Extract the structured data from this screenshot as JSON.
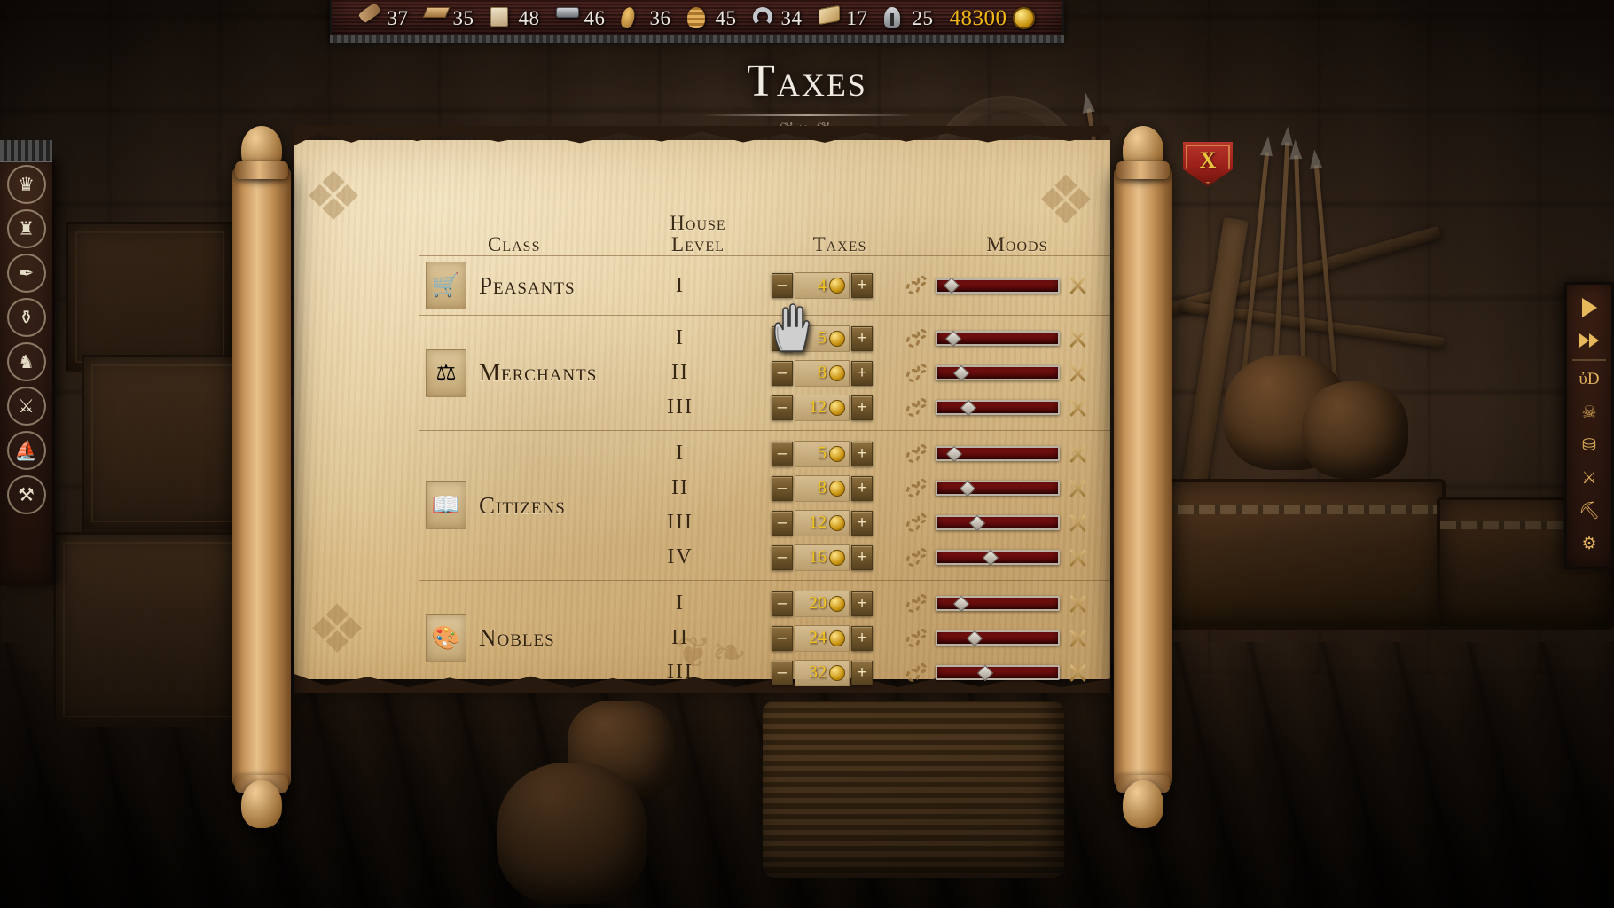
{
  "window": {
    "title": "Taxes"
  },
  "resources": [
    {
      "icon": "log-icon",
      "name": "wood",
      "value": "37"
    },
    {
      "icon": "plank-icon",
      "name": "planks",
      "value": "35"
    },
    {
      "icon": "stone-icon",
      "name": "stone",
      "value": "48"
    },
    {
      "icon": "iron-icon",
      "name": "iron",
      "value": "46"
    },
    {
      "icon": "wheat-icon",
      "name": "grain",
      "value": "36"
    },
    {
      "icon": "hive-icon",
      "name": "beehive",
      "value": "45"
    },
    {
      "icon": "horseshoe-icon",
      "name": "horseshoe",
      "value": "34"
    },
    {
      "icon": "scroll-icon",
      "name": "parchment",
      "value": "17"
    },
    {
      "icon": "helmet-icon",
      "name": "armor",
      "value": "25"
    },
    {
      "icon": "coin-icon",
      "name": "gold",
      "value": "48300"
    }
  ],
  "close_button": {
    "label": "X"
  },
  "table": {
    "headers": {
      "class": "Class",
      "house_level_line1": "House",
      "house_level_line2": "Level",
      "taxes": "Taxes",
      "moods": "Moods"
    },
    "groups": [
      {
        "name": "Peasants",
        "icon": "cart-icon",
        "rows": [
          {
            "level": "I",
            "tax": "4",
            "mood_pct": 12
          }
        ]
      },
      {
        "name": "Merchants",
        "icon": "scales-icon",
        "rows": [
          {
            "level": "I",
            "tax": "5",
            "mood_pct": 13
          },
          {
            "level": "II",
            "tax": "8",
            "mood_pct": 20
          },
          {
            "level": "III",
            "tax": "12",
            "mood_pct": 26
          }
        ]
      },
      {
        "name": "Citizens",
        "icon": "book-icon",
        "rows": [
          {
            "level": "I",
            "tax": "5",
            "mood_pct": 14
          },
          {
            "level": "II",
            "tax": "8",
            "mood_pct": 25
          },
          {
            "level": "III",
            "tax": "12",
            "mood_pct": 33
          },
          {
            "level": "IV",
            "tax": "16",
            "mood_pct": 44
          }
        ]
      },
      {
        "name": "Nobles",
        "icon": "palette-icon",
        "rows": [
          {
            "level": "I",
            "tax": "20",
            "mood_pct": 20
          },
          {
            "level": "II",
            "tax": "24",
            "mood_pct": 31
          },
          {
            "level": "III",
            "tax": "32",
            "mood_pct": 40
          }
        ]
      }
    ],
    "stepper": {
      "minus": "–",
      "plus": "+"
    }
  },
  "left_menu": [
    {
      "icon": "crown-icon",
      "glyph": "♛",
      "name": "kingdom"
    },
    {
      "icon": "tower-icon",
      "glyph": "♜",
      "name": "buildings"
    },
    {
      "icon": "quill-icon",
      "glyph": "✒",
      "name": "decrees"
    },
    {
      "icon": "ham-icon",
      "glyph": "⚱",
      "name": "food"
    },
    {
      "icon": "knight-icon",
      "glyph": "♞",
      "name": "army"
    },
    {
      "icon": "swords-icon",
      "glyph": "⚔",
      "name": "war"
    },
    {
      "icon": "ship-icon",
      "glyph": "⛵",
      "name": "trade"
    },
    {
      "icon": "compass-icon",
      "glyph": "⚒",
      "name": "builders"
    }
  ],
  "right_menu": [
    {
      "icon": "play-icon",
      "glyph": "",
      "name": "play"
    },
    {
      "icon": "fast-forward-icon",
      "glyph": "",
      "name": "fast-forward"
    },
    {
      "icon": "magnifier-icon",
      "glyph": "ὐD",
      "name": "search"
    },
    {
      "icon": "skull-icon",
      "glyph": "☠",
      "name": "deaths"
    },
    {
      "icon": "chest-icon",
      "glyph": "⛁",
      "name": "treasury"
    },
    {
      "icon": "swords-icon",
      "glyph": "⚔",
      "name": "battles"
    },
    {
      "icon": "pot-icon",
      "glyph": "⛏",
      "name": "storage"
    },
    {
      "icon": "gear-icon",
      "glyph": "⚙",
      "name": "settings"
    }
  ],
  "colors": {
    "parchment": "#e3cb9c",
    "mood_bar": "#8e1414",
    "gold_text": "#f3c51d",
    "close_red": "#9a2019"
  }
}
